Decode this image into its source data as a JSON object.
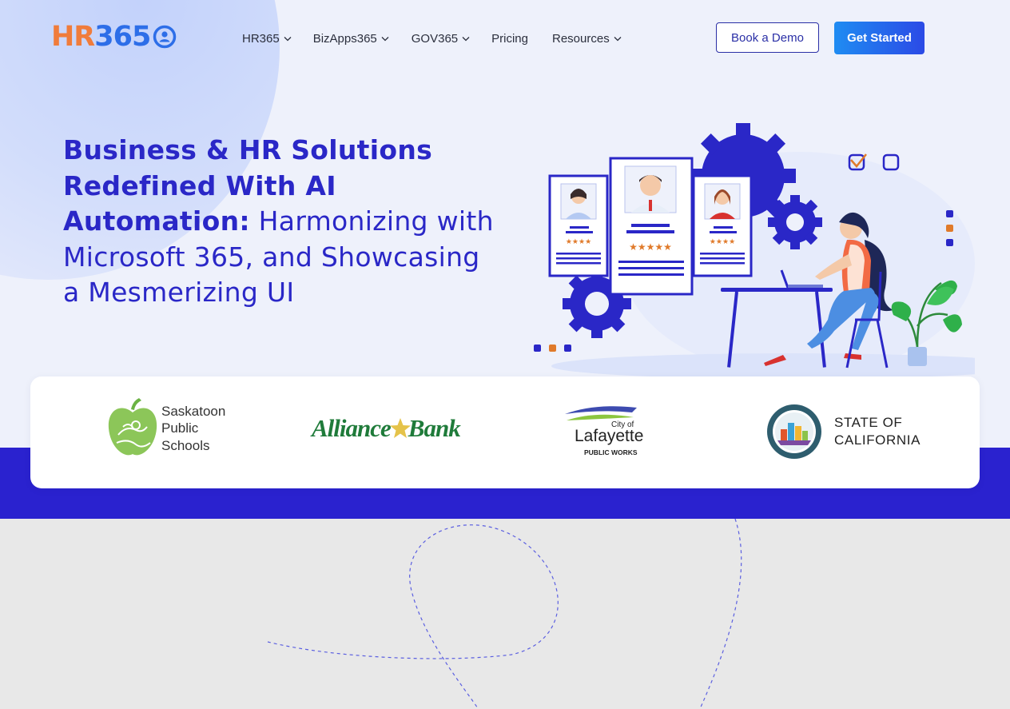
{
  "brand": {
    "logo_prefix": "HR",
    "logo_number": "365",
    "colors": {
      "orange": "#f07c3b",
      "blue": "#2d6ee8",
      "primary": "#2a27c7",
      "band": "#2a22cf"
    }
  },
  "nav": {
    "items": [
      {
        "label": "HR365",
        "has_dropdown": true
      },
      {
        "label": "BizApps365",
        "has_dropdown": true
      },
      {
        "label": "GOV365",
        "has_dropdown": true
      },
      {
        "label": "Pricing",
        "has_dropdown": false
      },
      {
        "label": "Resources",
        "has_dropdown": true
      }
    ],
    "book_demo": "Book a Demo",
    "get_started": "Get Started"
  },
  "hero": {
    "line1": "Business & HR Solutions",
    "line2": "Redefined With AI",
    "line3_bold": "Automation:",
    "line3_light": " Harmonizing with",
    "line4": "Microsoft 365, and Showcasing",
    "line5": "a Mesmerizing UI",
    "illustration_icon": "hr-profiles-gears-illustration",
    "rating_stars": "★★★★",
    "rating_stars_center": "★★★★★"
  },
  "clients": {
    "saskatoon": {
      "line1": "Saskatoon",
      "line2": "Public",
      "line3": "Schools",
      "icon": "apple-logo-icon"
    },
    "alliance": {
      "part1": "Alliance",
      "part2": "Bank"
    },
    "lafayette": {
      "top": "City of",
      "name": "Lafayette",
      "sub": "PUBLIC WORKS"
    },
    "california": {
      "line1": "STATE OF",
      "line2": "CALIFORNIA",
      "icon": "state-seal-icon"
    }
  }
}
